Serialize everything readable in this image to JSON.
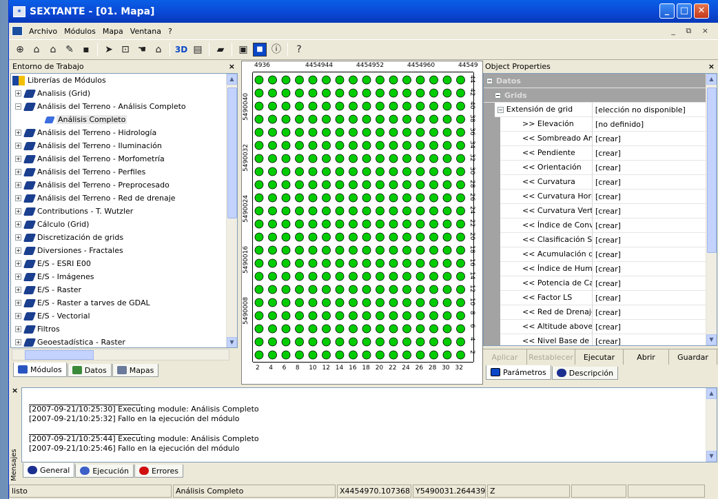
{
  "window": {
    "title": "SEXTANTE - [01. Mapa]"
  },
  "menu": [
    "Archivo",
    "Módulos",
    "Mapa",
    "Ventana",
    "?"
  ],
  "left_panel": {
    "title": "Entorno de Trabajo",
    "close": "×",
    "root": "Librerías de Módulos",
    "items": [
      {
        "label": "Analisis (Grid)",
        "exp": "+",
        "indent": 0
      },
      {
        "label": "Análisis del Terreno - Análisis Completo",
        "exp": "−",
        "indent": 0
      },
      {
        "label": "Análisis Completo",
        "exp": "",
        "indent": 1
      },
      {
        "label": "Análisis del Terreno - Hidrología",
        "exp": "+",
        "indent": 0
      },
      {
        "label": "Análisis del Terreno - Iluminación",
        "exp": "+",
        "indent": 0
      },
      {
        "label": "Análisis del Terreno - Morfometría",
        "exp": "+",
        "indent": 0
      },
      {
        "label": "Análisis del Terreno - Perfiles",
        "exp": "+",
        "indent": 0
      },
      {
        "label": "Análisis del Terreno - Preprocesado",
        "exp": "+",
        "indent": 0
      },
      {
        "label": "Análisis del Terreno - Red de drenaje",
        "exp": "+",
        "indent": 0
      },
      {
        "label": "Contributions - T. Wutzler",
        "exp": "+",
        "indent": 0
      },
      {
        "label": "Cálculo (Grid)",
        "exp": "+",
        "indent": 0
      },
      {
        "label": "Discretización de grids",
        "exp": "+",
        "indent": 0
      },
      {
        "label": "Diversiones - Fractales",
        "exp": "+",
        "indent": 0
      },
      {
        "label": "E/S - ESRI E00",
        "exp": "+",
        "indent": 0
      },
      {
        "label": "E/S - Imágenes",
        "exp": "+",
        "indent": 0
      },
      {
        "label": "E/S - Raster",
        "exp": "+",
        "indent": 0
      },
      {
        "label": "E/S - Raster a tarves de GDAL",
        "exp": "+",
        "indent": 0
      },
      {
        "label": "E/S - Vectorial",
        "exp": "+",
        "indent": 0
      },
      {
        "label": "Filtros",
        "exp": "+",
        "indent": 0
      },
      {
        "label": "Geoestadística - Raster",
        "exp": "+",
        "indent": 0
      }
    ],
    "tabs": [
      "Módulos",
      "Datos",
      "Mapas"
    ]
  },
  "map": {
    "top_ticks": [
      "4936",
      "4454944",
      "4454952",
      "4454960",
      "44549"
    ],
    "left_ticks": [
      "5490040",
      "5490032",
      "5490024",
      "5490016",
      "5490008"
    ],
    "right_ticks": [
      "44",
      "42",
      "40",
      "38",
      "36",
      "34",
      "32",
      "30",
      "28",
      "26",
      "24",
      "22",
      "20",
      "18",
      "16",
      "14",
      "12",
      "10",
      "8",
      "6",
      "4",
      "2"
    ],
    "bottom_ticks": [
      "2",
      "4",
      "6",
      "8",
      "10",
      "12",
      "14",
      "16",
      "18",
      "20",
      "22",
      "24",
      "26",
      "28",
      "30",
      "32"
    ],
    "dot_color": "#00cc00"
  },
  "props": {
    "title": "Object Properties",
    "close": "×",
    "section": "Datos",
    "subsection": "Grids",
    "group": {
      "label": "Extensión de grid",
      "value": "[elección no disponible]"
    },
    "rows": [
      {
        "k": ">> Elevación",
        "v": "[no definido]"
      },
      {
        "k": "<< Sombreado Analítico",
        "v": "[crear]"
      },
      {
        "k": "<< Pendiente",
        "v": "[crear]"
      },
      {
        "k": "<< Orientación",
        "v": "[crear]"
      },
      {
        "k": "<< Curvatura",
        "v": "[crear]"
      },
      {
        "k": "<< Curvatura Horizontal",
        "v": "[crear]"
      },
      {
        "k": "<< Curvatura Vertical",
        "v": "[crear]"
      },
      {
        "k": "<< Índice de Convergencia",
        "v": "[crear]"
      },
      {
        "k": "<< Clasificación Semántica",
        "v": "[crear]"
      },
      {
        "k": "<< Acumulación de flujo",
        "v": "[crear]"
      },
      {
        "k": "<< Índice de Humedad",
        "v": "[crear]"
      },
      {
        "k": "<< Potencia de Cauce",
        "v": "[crear]"
      },
      {
        "k": "<< Factor LS",
        "v": "[crear]"
      },
      {
        "k": "<< Red de Drenaje",
        "v": "[crear]"
      },
      {
        "k": "<< Altitude above",
        "v": "[crear]"
      },
      {
        "k": "<< Nivel Base de Red",
        "v": "[crear]"
      }
    ],
    "buttons": [
      "Aplicar",
      "Restablecer",
      "Ejecutar",
      "Abrir",
      "Guardar"
    ],
    "tabs": [
      "Parámetros",
      "Descripción"
    ]
  },
  "messages": {
    "side_label": "Mensajes",
    "lines": [
      "[2007-09-21/10:25:30] Executing module: Análisis Completo",
      "[2007-09-21/10:25:32] Fallo en la ejecución del módulo",
      "[2007-09-21/10:25:44] Executing module: Análisis Completo",
      "[2007-09-21/10:25:46] Fallo en la ejecución del módulo"
    ],
    "tabs": [
      "General",
      "Ejecución",
      "Errores"
    ]
  },
  "status": [
    "listo",
    "Análisis Completo",
    "X4454970.107368",
    "Y5490031.264439",
    "Z"
  ]
}
